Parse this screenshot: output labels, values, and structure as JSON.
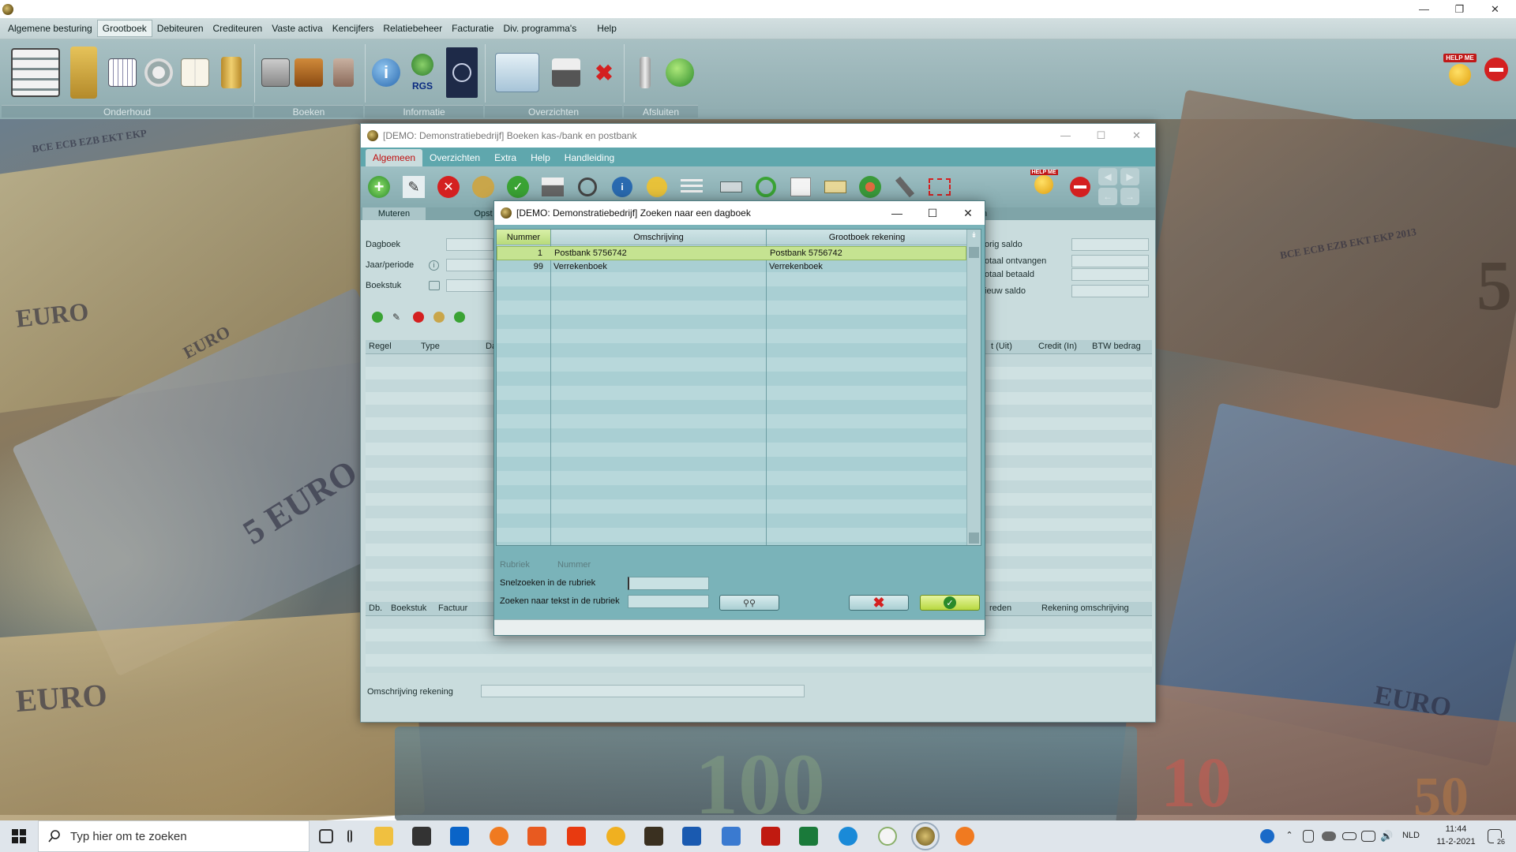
{
  "main_window": {
    "menus": [
      {
        "label": "Algemene besturing"
      },
      {
        "label": "Grootboek",
        "active": true
      },
      {
        "label": "Debiteuren"
      },
      {
        "label": "Crediteuren"
      },
      {
        "label": "Vaste activa"
      },
      {
        "label": "Kencijfers"
      },
      {
        "label": "Relatiebeheer"
      },
      {
        "label": "Facturatie"
      },
      {
        "label": "Div. programma's"
      },
      {
        "label": "Help"
      }
    ],
    "toolbar_groups": [
      "Onderhoud",
      "Boeken",
      "Informatie",
      "Overzichten",
      "Afsluiten"
    ],
    "rgs_label": "RGS",
    "help_badge": "HELP ME"
  },
  "boeken_window": {
    "title": "[DEMO: Demonstratiebedrijf]  Boeken kas-/bank en postbank",
    "tabs": [
      "Algemeen",
      "Overzichten",
      "Extra",
      "Help",
      "Handleiding"
    ],
    "subbar": {
      "left": "Muteren",
      "mid": "Opst",
      "right": "n"
    },
    "fields": {
      "dagboek": "Dagboek",
      "jaar_periode": "Jaar/periode",
      "boekstuk": "Boekstuk"
    },
    "saldo_labels": [
      "orig saldo",
      "otaal ontvangen",
      "otaal betaald",
      "ieuw saldo"
    ],
    "grid_top_headers": [
      "Regel",
      "Type",
      "Da",
      "t (Uit)",
      "Credit (In)",
      "BTW bedrag"
    ],
    "grid_bottom_headers": [
      "Db.",
      "Boekstuk",
      "Factuur",
      "reden",
      "Rekening omschrijving"
    ],
    "omschrijving_rekening": "Omschrijving rekening"
  },
  "dialog": {
    "title": "[DEMO: Demonstratiebedrijf]  Zoeken naar een dagboek",
    "columns": [
      "Nummer",
      "Omschrijving",
      "Grootboek rekening"
    ],
    "rows": [
      {
        "nummer": "1",
        "omschrijving": "Postbank 5756742",
        "grootboek": "Postbank 5756742",
        "selected": true
      },
      {
        "nummer": "99",
        "omschrijving": "Verrekenboek",
        "grootboek": "Verrekenboek",
        "selected": false
      }
    ],
    "rubriek_label": "Rubriek",
    "rubriek_value": "Nummer",
    "snelzoeken_label": "Snelzoeken in de rubriek",
    "snelzoeken_value": "",
    "zoeken_tekst_label": "Zoeken naar tekst in de rubriek",
    "zoeken_tekst_value": ""
  },
  "desktop": {
    "note_texts": [
      "EURO",
      "5 EURO",
      "EURO",
      "BCE ECB EZB EKT EKP",
      "BCE ECB EZB EKT EKP 2013",
      "EURO",
      "100",
      "10",
      "50",
      "5",
      "EURO"
    ]
  },
  "taskbar": {
    "search_placeholder": "Typ hier om te zoeken",
    "language": "NLD",
    "time": "11:44",
    "date": "11-2-2021",
    "notifications": "26"
  },
  "colors": {
    "accent_teal": "#5fa7ad",
    "selection_green": "#c5e391",
    "cancel_red": "#d42020",
    "ok_green": "#3aa334"
  }
}
